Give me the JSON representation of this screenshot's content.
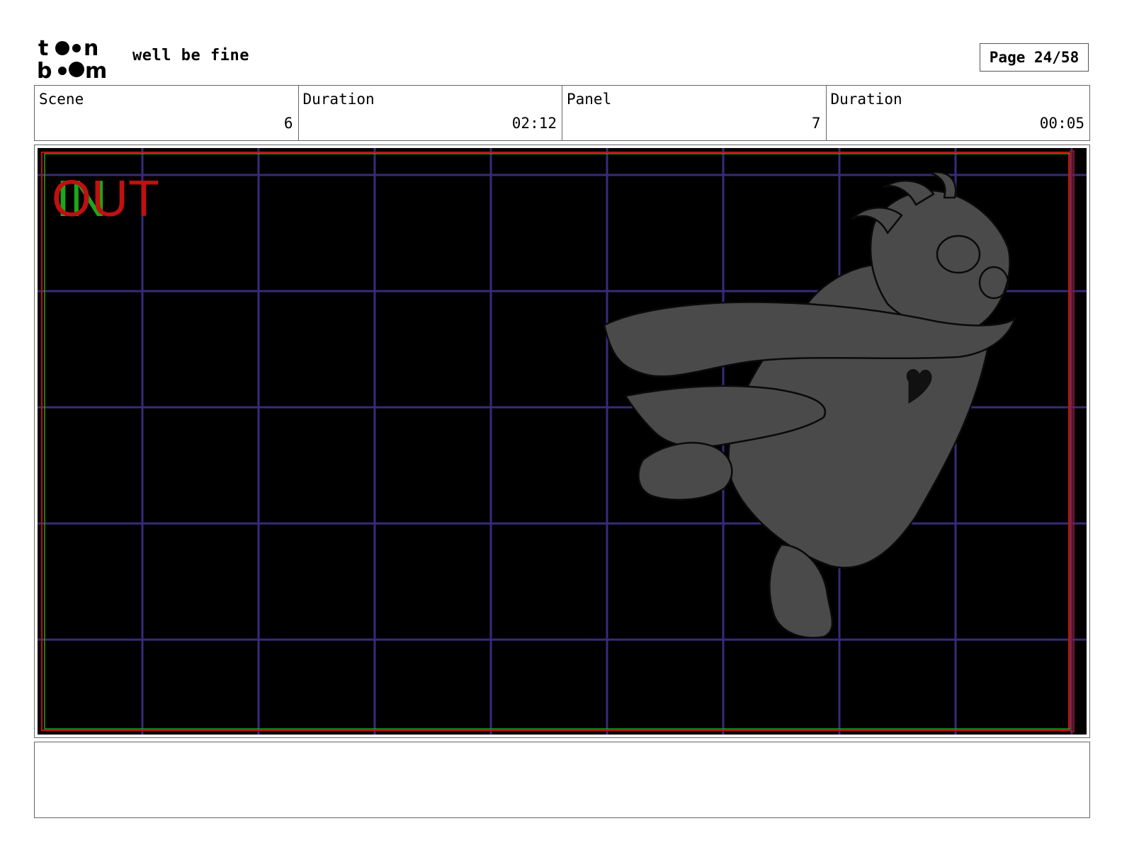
{
  "header": {
    "logo_text": "toon boom",
    "project_title": "well be fine",
    "page_label": "Page 24/58"
  },
  "info": [
    {
      "label": "Scene",
      "value": "6"
    },
    {
      "label": "Duration",
      "value": "02:12"
    },
    {
      "label": "Panel",
      "value": "7"
    },
    {
      "label": "Duration",
      "value": "00:05"
    }
  ],
  "panel": {
    "in_marker": "IN",
    "out_marker": "OUT",
    "background_color": "#000000",
    "grid_color": "#3a2a7a",
    "safe_frame_color": "#c01010",
    "in_color": "#1aa81a",
    "character_fill": "#4a4a4a"
  },
  "notes": {
    "text": ""
  }
}
